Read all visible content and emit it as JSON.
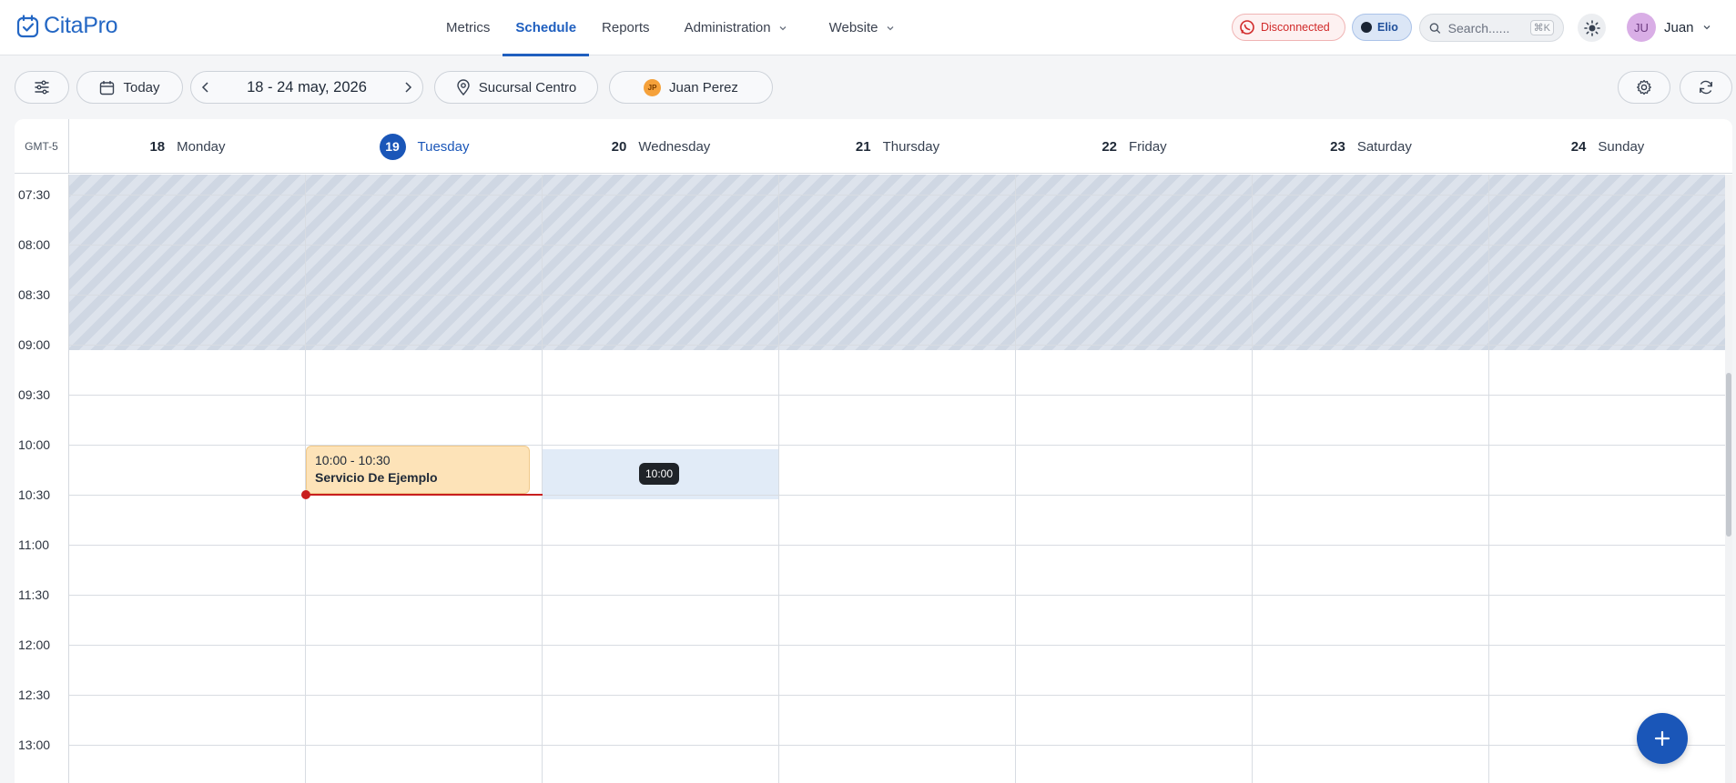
{
  "app": {
    "name": "CitaPro"
  },
  "nav": {
    "links": [
      {
        "label": "Metrics",
        "active": false,
        "dropdown": false
      },
      {
        "label": "Schedule",
        "active": true,
        "dropdown": false
      },
      {
        "label": "Reports",
        "active": false,
        "dropdown": false
      },
      {
        "label": "Administration",
        "active": false,
        "dropdown": true
      },
      {
        "label": "Website",
        "active": false,
        "dropdown": true
      }
    ]
  },
  "header": {
    "connection_status": "Disconnected",
    "assistant": "Elio",
    "search_placeholder": "Search......",
    "search_shortcut": "⌘K",
    "user_initials": "JU",
    "user_name": "Juan"
  },
  "toolbar": {
    "today_label": "Today",
    "date_range": "18 - 24 may, 2026",
    "branch": "Sucursal Centro",
    "staff_name": "Juan Perez",
    "staff_initials": "JP"
  },
  "calendar": {
    "timezone": "GMT-5",
    "days": [
      {
        "num": "18",
        "label": "Monday",
        "today": false
      },
      {
        "num": "19",
        "label": "Tuesday",
        "today": true
      },
      {
        "num": "20",
        "label": "Wednesday",
        "today": false
      },
      {
        "num": "21",
        "label": "Thursday",
        "today": false
      },
      {
        "num": "22",
        "label": "Friday",
        "today": false
      },
      {
        "num": "23",
        "label": "Saturday",
        "today": false
      },
      {
        "num": "24",
        "label": "Sunday",
        "today": false
      }
    ],
    "times": [
      "07:30",
      "08:00",
      "08:30",
      "09:00",
      "09:30",
      "10:00",
      "10:30",
      "11:00",
      "11:30",
      "12:00",
      "12:30",
      "13:00"
    ],
    "hover_tooltip": "10:00",
    "events": [
      {
        "time": "10:00 - 10:30",
        "title": "Servicio De Ejemplo",
        "day": "Tuesday"
      }
    ]
  },
  "colors": {
    "brand": "#1a56b8",
    "event_bg": "#fde3b8",
    "now_line": "#c81e1e",
    "disconnected": "#d12a2a"
  }
}
